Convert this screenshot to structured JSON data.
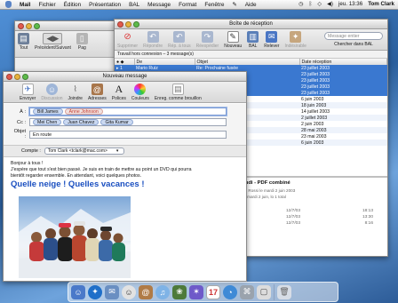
{
  "menubar": {
    "app": "Mail",
    "items": [
      "Fichier",
      "Édition",
      "Présentation",
      "BAL",
      "Message",
      "Format",
      "Fenêtre"
    ],
    "help": "Aide",
    "clock": "jeu. 13:36",
    "user": "Tom Clark"
  },
  "desktop_window": {
    "toolbar": [
      {
        "label": "Tout"
      },
      {
        "label": "Précédent/Suivant"
      },
      {
        "label": "Pag"
      }
    ]
  },
  "mailbox": {
    "title": "Boîte de réception",
    "toolbar": [
      {
        "label": "Supprimer",
        "enabled": false
      },
      {
        "label": "Répondre",
        "enabled": false
      },
      {
        "label": "Rép. à tous",
        "enabled": false
      },
      {
        "label": "Réexpédier",
        "enabled": false
      },
      {
        "label": "Nouveau",
        "enabled": true
      },
      {
        "label": "BAL",
        "enabled": true
      },
      {
        "label": "Relever",
        "enabled": true
      },
      {
        "label": "Indésirable",
        "enabled": false
      }
    ],
    "search_placeholder": "Message entier",
    "search_label": "Chercher dans BAL",
    "status": "Travail hors connexion – 3 message(s)",
    "columns": [
      "De",
      "Objet",
      "Date réception"
    ],
    "rows": [
      {
        "from": "Mario Ruiz",
        "subject": "Re: Prochaine fusée",
        "date": "23 juillet 2003",
        "sel": true
      },
      {
        "from": "",
        "subject": "",
        "date": "23 juillet 2003",
        "sel": true
      },
      {
        "from": "",
        "subject": "",
        "date": "23 juillet 2003",
        "sel": true
      },
      {
        "from": "",
        "subject": "",
        "date": "23 juillet 2003",
        "sel": true
      },
      {
        "from": "",
        "subject": "",
        "date": "23 juillet 2003",
        "sel": true
      },
      {
        "from": "",
        "subject": "",
        "date": "6 juin 2003",
        "sel": false
      },
      {
        "from": "",
        "subject": "",
        "date": "18 juin 2003",
        "sel": false
      },
      {
        "from": "",
        "subject": "",
        "date": "14 juillet 2003",
        "sel": false
      },
      {
        "from": "",
        "subject": "",
        "date": "2 juillet 2003",
        "sel": false
      },
      {
        "from": "",
        "subject": "",
        "date": "2 juin 2003",
        "sel": false
      },
      {
        "from": "",
        "subject": "",
        "date": "28 mai 2003",
        "sel": false
      },
      {
        "from": "",
        "subject": "",
        "date": "23 mai 2003",
        "sel": false
      },
      {
        "from": "",
        "subject": "",
        "date": "6 juin 2003",
        "sel": false
      }
    ],
    "preview_title": "jeudi - PDF combiné",
    "preview_line1": "Jim Rossi le mardi 2 juin 2003",
    "preview_line2": "e il mardi 2 juin, lo 1 total",
    "preview_rows": [
      [
        "12/7/03",
        "18:13"
      ],
      [
        "12/7/03",
        "13:30"
      ],
      [
        "12/7/03",
        "8:16"
      ]
    ]
  },
  "compose": {
    "title": "Nouveau message",
    "toolbar": [
      {
        "label": "Envoyer",
        "enabled": true
      },
      {
        "label": "Discussion",
        "enabled": false
      },
      {
        "label": "Joindre",
        "enabled": true
      },
      {
        "label": "Adresses",
        "enabled": true
      },
      {
        "label": "Polices",
        "enabled": true
      },
      {
        "label": "Couleurs",
        "enabled": true
      },
      {
        "label": "Enreg. comme brouillon",
        "enabled": true
      }
    ],
    "to_label": "À :",
    "to": [
      "Bill James",
      "Anne Johnson"
    ],
    "cc_label": "Cc :",
    "cc": [
      "Mei Chen",
      "Juan Chavez",
      "Gita Kumar"
    ],
    "subject_label": "Objet :",
    "subject": "En route",
    "account_label": "Compte :",
    "account": "Tom Clark <tclark@mac.com>",
    "body_line1": "Bonjour à tous !",
    "body_line2": "J'espère que tout s'est bien passé. Je suis en train de mettre au point un DVD qui pourra",
    "body_line3": "bientôt regarder ensemble. En attendant, voici quelques photos.",
    "headline": "Quelle neige ! Quelles vacances !"
  },
  "dock": {
    "icons": [
      "finder-icon",
      "safari-icon",
      "mail-icon",
      "ichat-icon",
      "addressbook-icon",
      "itunes-icon",
      "iphoto-icon",
      "imovie-icon",
      "ical-icon",
      "sherlock-icon",
      "system-prefs-icon",
      "ipod-icon",
      "trash-icon"
    ]
  },
  "colors": {
    "selection": "#3a78d0",
    "headline": "#1a4fc0"
  }
}
